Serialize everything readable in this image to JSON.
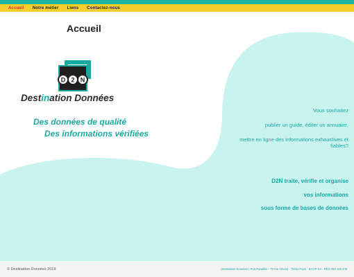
{
  "nav": {
    "items": [
      {
        "label": "Accueil"
      },
      {
        "label": "Notre métier"
      },
      {
        "label": "Liens"
      },
      {
        "label": "Contactez-nous"
      }
    ]
  },
  "page": {
    "title": "Accueil"
  },
  "logo": {
    "badge_letters": [
      "D",
      "2",
      "N"
    ],
    "wordmark_part1": "Dest",
    "wordmark_part2": "in",
    "wordmark_part3": "ation",
    "wordmark_part4": " Données"
  },
  "taglines": [
    "Des données de qualité",
    "Des informations vérifiées"
  ],
  "right_intro": [
    "Vous souhaitez",
    "publier un guide, éditer un annuaire,",
    "mettre en ligne des informations exhaustives et fiables?"
  ],
  "right_bold": [
    "D2N traite, vérifie et organise",
    "vos informations",
    "sous forme de bases de données"
  ],
  "footer": {
    "copyright": "© Destination Données 2019",
    "legal": "Destination Données | Port Parallèle - 70 rue Amelot - 75011 Paris - SCOP SA - RCS 492 106 209"
  },
  "colors": {
    "accent_teal": "#1aa9a1",
    "mint_bg": "#c9f3ef",
    "nav_yellow": "#f6cf2e",
    "active_red": "#e2262b"
  }
}
